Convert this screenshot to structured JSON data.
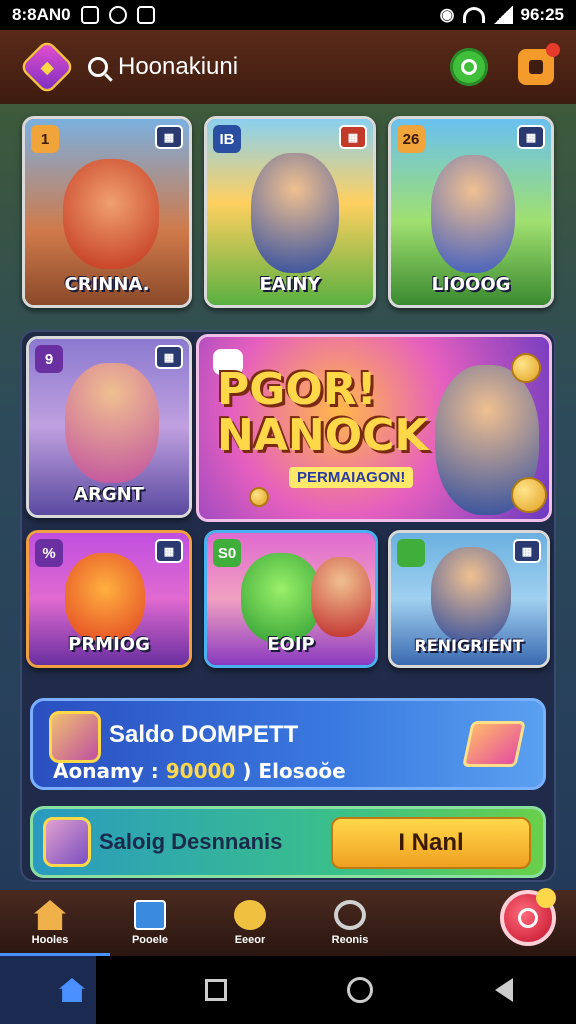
{
  "status_bar": {
    "left_text": "8:8AN0",
    "time": "96:25",
    "icons": [
      "gallery-icon",
      "whatsapp-icon",
      "app-icon",
      "vibrate-icon",
      "wifi-icon",
      "signal-icon"
    ]
  },
  "header": {
    "logo_icon": "gem-logo-icon",
    "search_label": "Hoonakiuni",
    "icons": [
      "search-icon",
      "chat-icon",
      "notification-icon"
    ]
  },
  "game_cards_top": [
    {
      "badge": "1",
      "label": "CRINNA."
    },
    {
      "badge": "IB",
      "label": "EAINY"
    },
    {
      "badge": "26",
      "label": "LIOOOG"
    }
  ],
  "game_card_left": {
    "badge": "9",
    "label": "ARGNT"
  },
  "featured_banner": {
    "title_line1": "PGOR!",
    "title_line2": "NANOCK",
    "subtitle": "PERMAIAGON!"
  },
  "game_cards_bottom": [
    {
      "badge": "%",
      "label": "PRMIOG"
    },
    {
      "badge": "S0",
      "label": "EOIP"
    },
    {
      "badge": "",
      "label": "RENIGRIENT"
    }
  ],
  "wallet": {
    "title": "Saldo DOMPETT",
    "line_prefix": "Aonamy : ",
    "amount": "90000",
    "line_suffix": " ) Elosoŏe"
  },
  "deposit": {
    "title": "Saloig Desnnanis",
    "button_label": "I Nanl"
  },
  "bottom_nav": [
    {
      "label": "Hooles",
      "icon": "home-icon"
    },
    {
      "label": "Pooele",
      "icon": "promo-icon"
    },
    {
      "label": "Eeeor",
      "icon": "deposit-icon"
    },
    {
      "label": "Reonis",
      "icon": "account-icon"
    }
  ],
  "colors": {
    "accent": "#4a90ff",
    "header_bg": "#5a2a18",
    "gold": "#ffd84a"
  }
}
